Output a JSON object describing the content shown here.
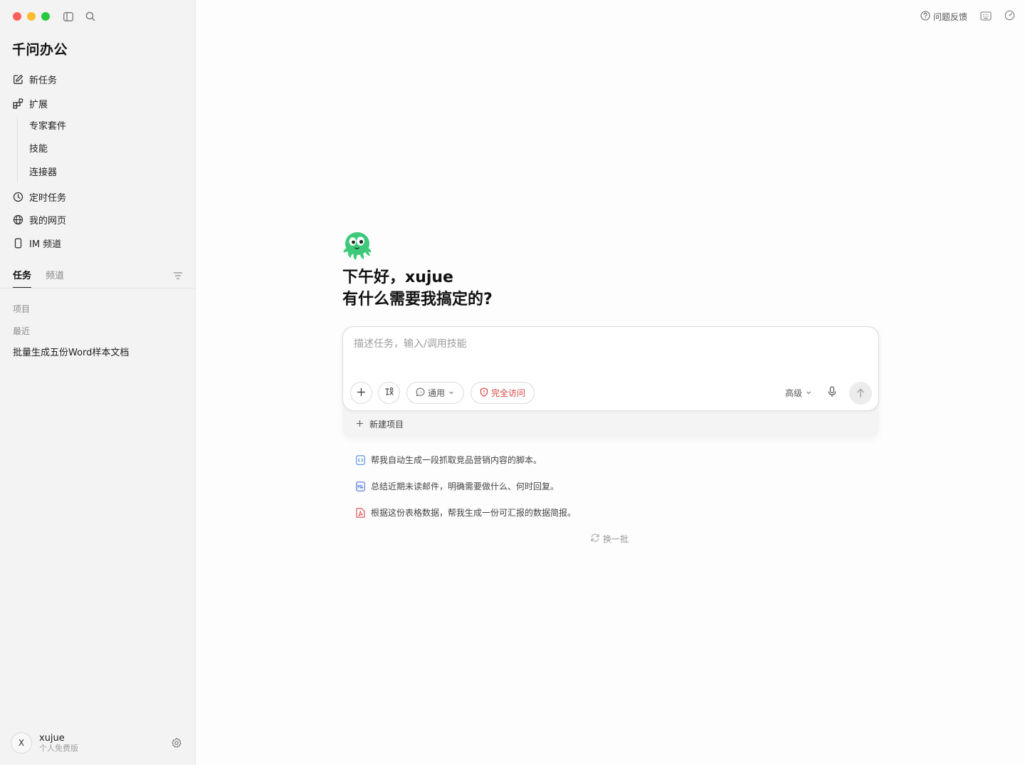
{
  "app": {
    "brand": "千问办公"
  },
  "sidebar": {
    "nav": [
      {
        "label": "新任务",
        "icon": "edit-icon"
      },
      {
        "label": "扩展",
        "icon": "extension-icon"
      }
    ],
    "extension_items": [
      "专家套件",
      "技能",
      "连接器"
    ],
    "nav2": [
      {
        "label": "定时任务",
        "icon": "clock-icon"
      },
      {
        "label": "我的网页",
        "icon": "globe-icon"
      },
      {
        "label": "IM 频道",
        "icon": "phone-icon"
      }
    ],
    "tabs": [
      {
        "label": "任务",
        "active": true
      },
      {
        "label": "频道",
        "active": false
      }
    ],
    "sections": {
      "projects": "项目",
      "recent": "最近"
    },
    "recent_items": [
      "批量生成五份Word样本文档"
    ],
    "profile": {
      "initial": "X",
      "name": "xujue",
      "plan": "个人免费版"
    }
  },
  "topbar": {
    "feedback_label": "问题反馈"
  },
  "main": {
    "greeting_line1": "下午好，xujue",
    "greeting_line2": "有什么需要我搞定的?",
    "input": {
      "placeholder": "描述任务，输入/调用技能",
      "value": "",
      "mode_label": "通用",
      "access_label": "完全访问",
      "advanced_label": "高级"
    },
    "new_project_label": "新建项目",
    "suggestions": [
      {
        "text": "帮我自动生成一段抓取竞品营销内容的脚本。",
        "icon": "code-file-icon"
      },
      {
        "text": "总结近期未读邮件，明确需要做什么、何时回复。",
        "icon": "markdown-file-icon"
      },
      {
        "text": "根据这份表格数据，帮我生成一份可汇报的数据简报。",
        "icon": "pdf-file-icon"
      }
    ],
    "refresh_label": "换一批"
  },
  "colors": {
    "accent_red": "#d64141",
    "mascot_green": "#3ec97a",
    "sidebar_bg": "#f3f3f3"
  }
}
